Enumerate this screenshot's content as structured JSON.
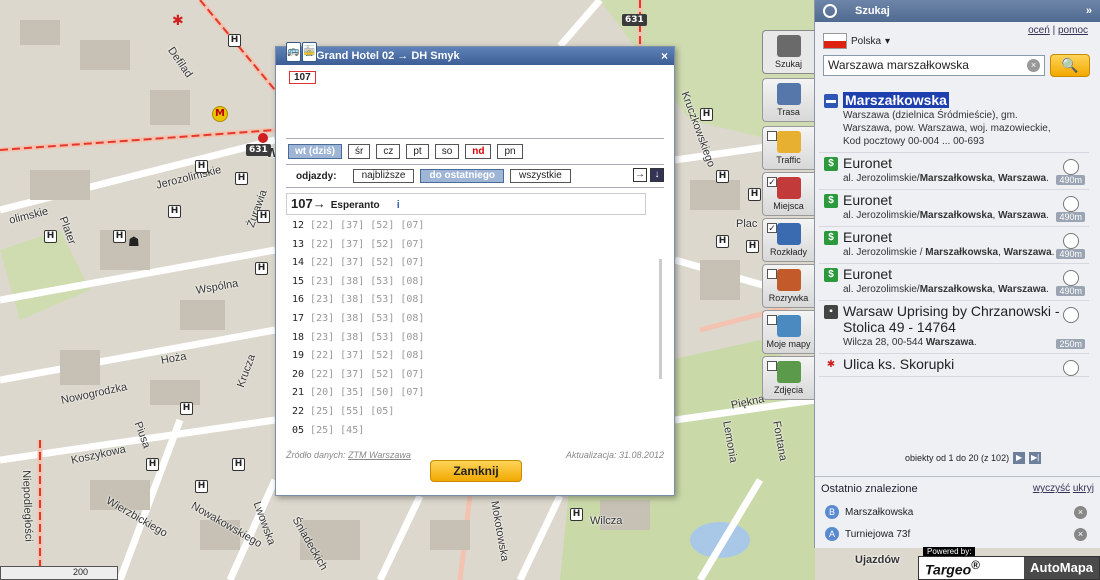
{
  "map": {
    "road_numbers": [
      "631",
      "631"
    ],
    "labels": {
      "defilad": "Defilad",
      "jerozolimskie": "Jerozolimskie",
      "olimskie": "olimskie",
      "plater": "Plater",
      "zurawia": "Żurawia",
      "wspolna": "Wspólna",
      "hoza": "Hoża",
      "krucza": "Krucza",
      "kruczkowskiego": "Kruczkowskiego",
      "piekna": "Piękna",
      "lemonia": "Lemonia",
      "fontana": "Fontana",
      "plac": "Plac",
      "nowogrodzka": "Nowogrodzka",
      "koszykowa": "Koszykowa",
      "piusa": "Piusa",
      "niepodleglosci": "Niepodległości",
      "wierzbickiego": "Wierzbickiego",
      "nowakowskiego": "Nowakowskiego",
      "lwowska": "Lwowska",
      "sniadeckich": "Śniadeckich",
      "mokotowska": "Mokotowska",
      "wilcza": "Wilcza",
      "ujazdow": "Ujazdów",
      "wa": "W"
    },
    "scale": "200"
  },
  "dialog": {
    "title": "Grand Hotel 02 → DH Smyk",
    "close_glyph": "×",
    "line_number": "107",
    "days": [
      {
        "label": "wt (dziś)",
        "active": true,
        "red": false
      },
      {
        "label": "śr",
        "active": false,
        "red": false
      },
      {
        "label": "cz",
        "active": false,
        "red": false
      },
      {
        "label": "pt",
        "active": false,
        "red": false
      },
      {
        "label": "so",
        "active": false,
        "red": false
      },
      {
        "label": "nd",
        "active": false,
        "red": true
      },
      {
        "label": "pn",
        "active": false,
        "red": false
      }
    ],
    "departures_label": "odjazdy:",
    "departure_options": [
      {
        "label": "najbliższe",
        "active": false
      },
      {
        "label": "do ostatniego",
        "active": true
      },
      {
        "label": "wszystkie",
        "active": false
      }
    ],
    "route": {
      "line": "107",
      "arrow": "→",
      "destination": "Esperanto",
      "info_glyph": "i"
    },
    "timetable": [
      {
        "hour": "12",
        "minutes": "[22] [37] [52] [07]"
      },
      {
        "hour": "13",
        "minutes": "[22] [37] [52] [07]"
      },
      {
        "hour": "14",
        "minutes": "[22] [37] [52] [07]"
      },
      {
        "hour": "15",
        "minutes": "[23] [38] [53] [08]"
      },
      {
        "hour": "16",
        "minutes": "[23] [38] [53] [08]"
      },
      {
        "hour": "17",
        "minutes": "[23] [38] [53] [08]"
      },
      {
        "hour": "18",
        "minutes": "[23] [38] [53] [08]"
      },
      {
        "hour": "19",
        "minutes": "[22] [37] [52] [08]"
      },
      {
        "hour": "20",
        "minutes": "[22] [37] [52] [07]"
      },
      {
        "hour": "21",
        "minutes": "[20] [35] [50] [07]"
      },
      {
        "hour": "22",
        "minutes": "[25] [55] [05]"
      },
      {
        "hour": "05",
        "minutes": "[25] [45]"
      }
    ],
    "source_label": "Źródło danych:",
    "source_link": "ZTM Warszawa",
    "updated": "Aktualizacja: 31.08.2012",
    "close_button": "Zamknij"
  },
  "tools": [
    {
      "label": "Szukaj",
      "checkbox": false,
      "checked": false
    },
    {
      "label": "Trasa",
      "checkbox": false,
      "checked": false
    },
    {
      "label": "Traffic",
      "checkbox": true,
      "checked": false
    },
    {
      "label": "Miejsca",
      "checkbox": true,
      "checked": true
    },
    {
      "label": "Rozkłady",
      "checkbox": true,
      "checked": true
    },
    {
      "label": "Rozrywka",
      "checkbox": true,
      "checked": false
    },
    {
      "label": "Moje mapy",
      "checkbox": true,
      "checked": false
    },
    {
      "label": "Zdjęcia",
      "checkbox": true,
      "checked": false
    }
  ],
  "panel": {
    "title": "Szukaj",
    "collapse_glyph": "»",
    "rate_link": "oceń",
    "help_link": "pomoc",
    "link_sep": "|",
    "country": "Polska",
    "search_value": "Warszawa marszałkowska",
    "clear_glyph": "×",
    "results": [
      {
        "title": "Marszałkowska",
        "highlight": true,
        "addr": "Warszawa (dzielnica Śródmieście), gm. Warszawa, pow. Warszawa, woj. mazowieckie, Kod pocztowy 00-004 ... 00-693",
        "dist": "",
        "icon": "street",
        "icon_glyph": "▬",
        "color": "#2e57b4"
      },
      {
        "title": "Euronet",
        "highlight": false,
        "addr": "al. Jerozolimskie/Marszałkowska, Warszawa.",
        "dist": "490m",
        "icon": "dollar",
        "icon_glyph": "$",
        "color": "#2c9a3c"
      },
      {
        "title": "Euronet",
        "highlight": false,
        "addr": "al. Jerozolimskie/Marszałkowska, Warszawa.",
        "dist": "490m",
        "icon": "dollar",
        "icon_glyph": "$",
        "color": "#2c9a3c"
      },
      {
        "title": "Euronet",
        "highlight": false,
        "addr": "al. Jerozolimskie / Marszałkowska, Warszawa.",
        "dist": "490m",
        "icon": "dollar",
        "icon_glyph": "$",
        "color": "#2c9a3c"
      },
      {
        "title": "Euronet",
        "highlight": false,
        "addr": "al. Jerozolimskie/Marszałkowska, Warszawa.",
        "dist": "490m",
        "icon": "dollar",
        "icon_glyph": "$",
        "color": "#2c9a3c"
      },
      {
        "title": "Warsaw Uprising by Chrzanowski - Stolica 49 - 14764",
        "highlight": false,
        "addr": "Wilcza 28, 00-544 Warszawa.",
        "dist": "250m",
        "icon": "photo",
        "icon_glyph": "▪",
        "color": "#444"
      },
      {
        "title": "Ulica ks. Skorupki",
        "highlight": false,
        "addr": "",
        "dist": "",
        "icon": "star",
        "icon_glyph": "✱",
        "color": "#d01f1f"
      }
    ],
    "pager_text": "obiekty od 1 do 20 (z 102)",
    "pager_next": "▶",
    "pager_last": "▶|",
    "recent_title": "Ostatnio znalezione",
    "clear_link": "wyczyść",
    "hide_link": "ukryj",
    "recent": [
      {
        "badge": "B",
        "label": "Marszałkowska"
      },
      {
        "badge": "A",
        "label": "Turniejowa 73f"
      }
    ],
    "powered_by": "Powered by:",
    "brand1": "Targeo",
    "reg": "®",
    "brand2": "AutoMapa"
  }
}
